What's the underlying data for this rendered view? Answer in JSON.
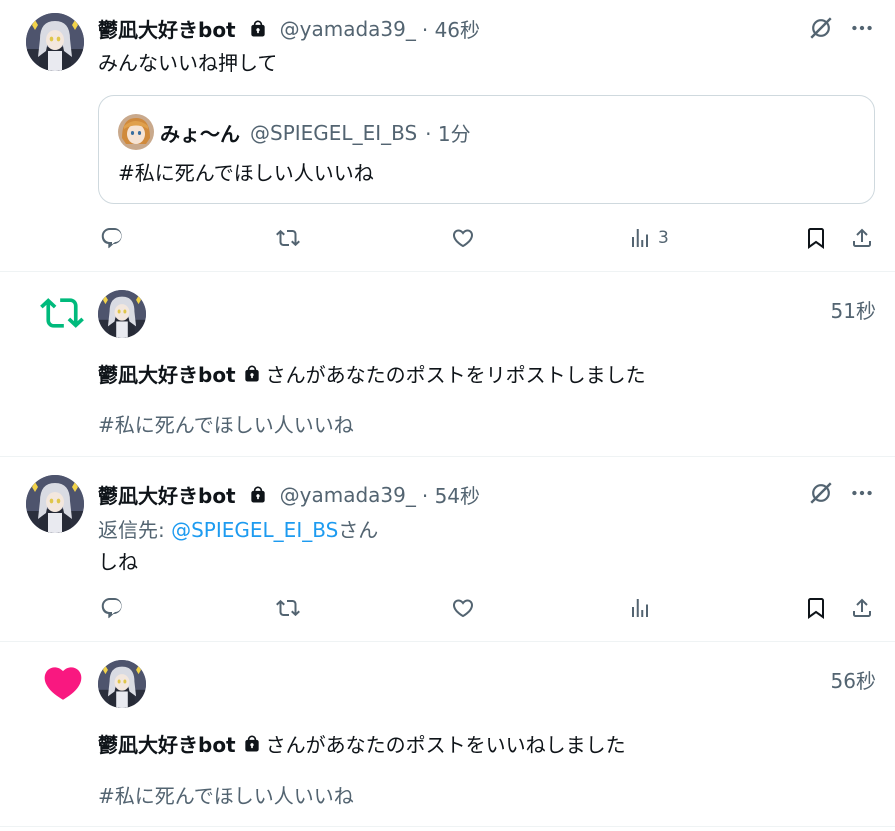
{
  "colors": {
    "text": "#0f1419",
    "secondary": "#536471",
    "link": "#1d9bf0",
    "retweet": "#00ba7c",
    "like": "#f91880",
    "border": "#cfd9de"
  },
  "post1": {
    "author": "鬱凪大好きbot",
    "handle": "@yamada39_",
    "time": "· 46秒",
    "text": "みんないいね押して",
    "quote": {
      "author": "みょ〜ん",
      "handle": "@SPIEGEL_EI_BS",
      "time": "· 1分",
      "text": "#私に死んでほしい人いいね"
    },
    "views": "3",
    "icons": [
      "grok-icon",
      "more-icon",
      "reply-icon",
      "retweet-icon",
      "like-icon",
      "analytics-icon",
      "bookmark-icon",
      "share-icon"
    ]
  },
  "notif_repost": {
    "time": "51秒",
    "author": "鬱凪大好きbot",
    "message": "さんがあなたのポストをリポストしました",
    "post_text": "#私に死んでほしい人いいね"
  },
  "post2": {
    "author": "鬱凪大好きbot",
    "handle": "@yamada39_",
    "time": "· 54秒",
    "reply_prefix": "返信先: ",
    "reply_to": "@SPIEGEL_EI_BS",
    "reply_suffix": "さん",
    "text": "しね"
  },
  "notif_like": {
    "time": "56秒",
    "author": "鬱凪大好きbot",
    "message": "さんがあなたのポストをいいねしました",
    "post_text": "#私に死んでほしい人いいね"
  }
}
